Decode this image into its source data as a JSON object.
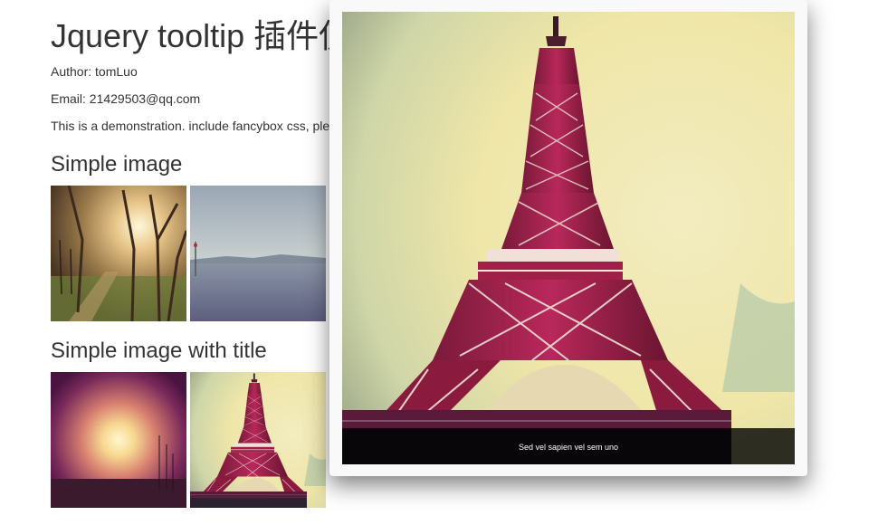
{
  "header": {
    "title": "Jquery tooltip 插件使用",
    "author": "Author: tomLuo",
    "email": "Email: 21429503@qq.com",
    "description": "This is a demonstration. include fancybox css, please"
  },
  "sections": [
    {
      "heading": "Simple image"
    },
    {
      "heading": "Simple image with title"
    }
  ],
  "tooltip": {
    "caption": "Sed vel sapien vel sem uno"
  },
  "colors": {
    "text": "#333333",
    "tooltip_bg": "#f9f9f9",
    "caption_bg": "rgba(0,0,0,0.8)"
  }
}
